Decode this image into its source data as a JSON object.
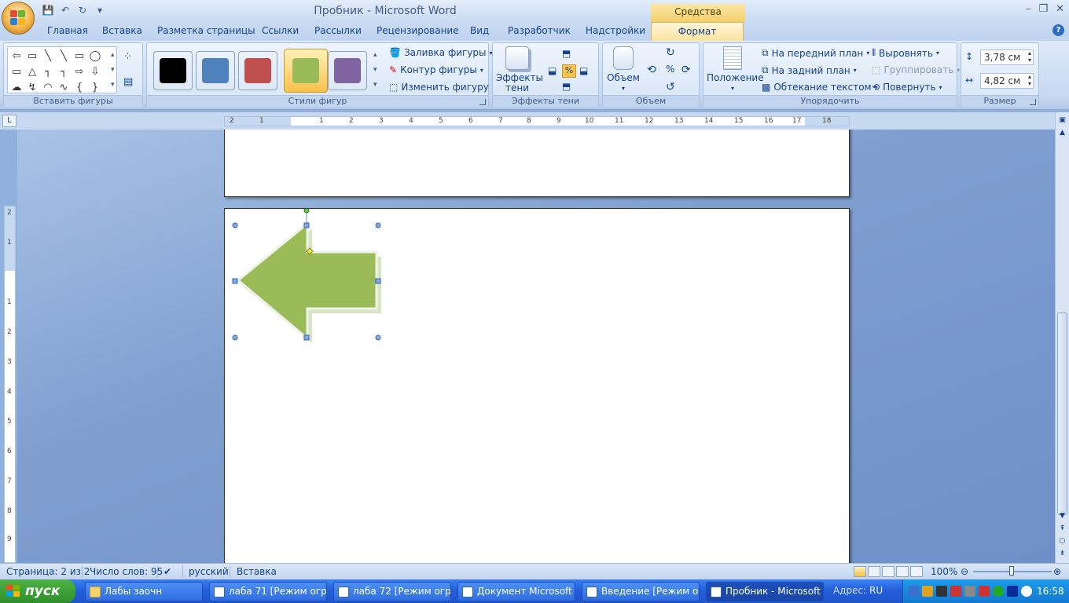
{
  "window": {
    "title": "Пробник - Microsoft Word",
    "context_tab": "Средства рисования",
    "controls": [
      "–",
      "❐",
      "✕"
    ]
  },
  "tabs": [
    "Главная",
    "Вставка",
    "Разметка страницы",
    "Ссылки",
    "Рассылки",
    "Рецензирование",
    "Вид",
    "Разработчик",
    "Надстройки",
    "Формат"
  ],
  "ribbon": {
    "insert_shapes": {
      "label": "Вставить фигуры",
      "shapes": [
        "⇦",
        "▭",
        "╲",
        "╲",
        "▭",
        "◯",
        "▭",
        "△",
        "┐",
        "┐",
        "⇨",
        "⇩",
        "☁",
        "↯",
        "◠",
        "∿",
        "{",
        "}"
      ]
    },
    "shape_styles": {
      "label": "Стили фигур",
      "swatches": [
        "#000000",
        "#4f81bd",
        "#c0504d",
        "#9bbb59",
        "#8064a2"
      ],
      "fill": "Заливка фигуры",
      "outline": "Контур фигуры",
      "change": "Изменить фигуру"
    },
    "shadow_effects": {
      "label": "Эффекты тени",
      "button": "Эффекты",
      "button2": "тени"
    },
    "volume": {
      "label": "Объем",
      "button": "Объем"
    },
    "arrange": {
      "label": "Упорядочить",
      "position": "Положение",
      "bring_front": "На передний план",
      "send_back": "На задний план",
      "wrap": "Обтекание текстом",
      "align": "Выровнять",
      "group": "Группировать",
      "rotate": "Повернуть"
    },
    "size": {
      "label": "Размер",
      "height": "3,78 см",
      "width": "4,82 см"
    }
  },
  "ruler": {
    "h_ticks": [
      "2",
      "1",
      "1",
      "2",
      "3",
      "4",
      "5",
      "6",
      "7",
      "8",
      "9",
      "10",
      "11",
      "12",
      "13",
      "14",
      "15",
      "16",
      "17",
      "18"
    ],
    "v_ticks": [
      "2",
      "1",
      "1",
      "2",
      "3",
      "4",
      "5",
      "6",
      "7",
      "8",
      "9"
    ]
  },
  "document": {
    "shape": {
      "type": "left-arrow",
      "fill": "#9bbb59"
    }
  },
  "status": {
    "page": "Страница: 2 из 2",
    "words": "Число слов: 95",
    "language": "русский",
    "mode": "Вставка",
    "zoom": "100%"
  },
  "taskbar": {
    "start": "пуск",
    "tasks": [
      "Лабы заочн",
      "лаба 71 [Режим огр...",
      "лаба 72 [Режим огр...",
      "Документ Microsoft ...",
      "Введение [Режим ог...",
      "Пробник - Microsoft ..."
    ],
    "address": "Адрес:",
    "lang": "RU",
    "clock": "16:58"
  }
}
